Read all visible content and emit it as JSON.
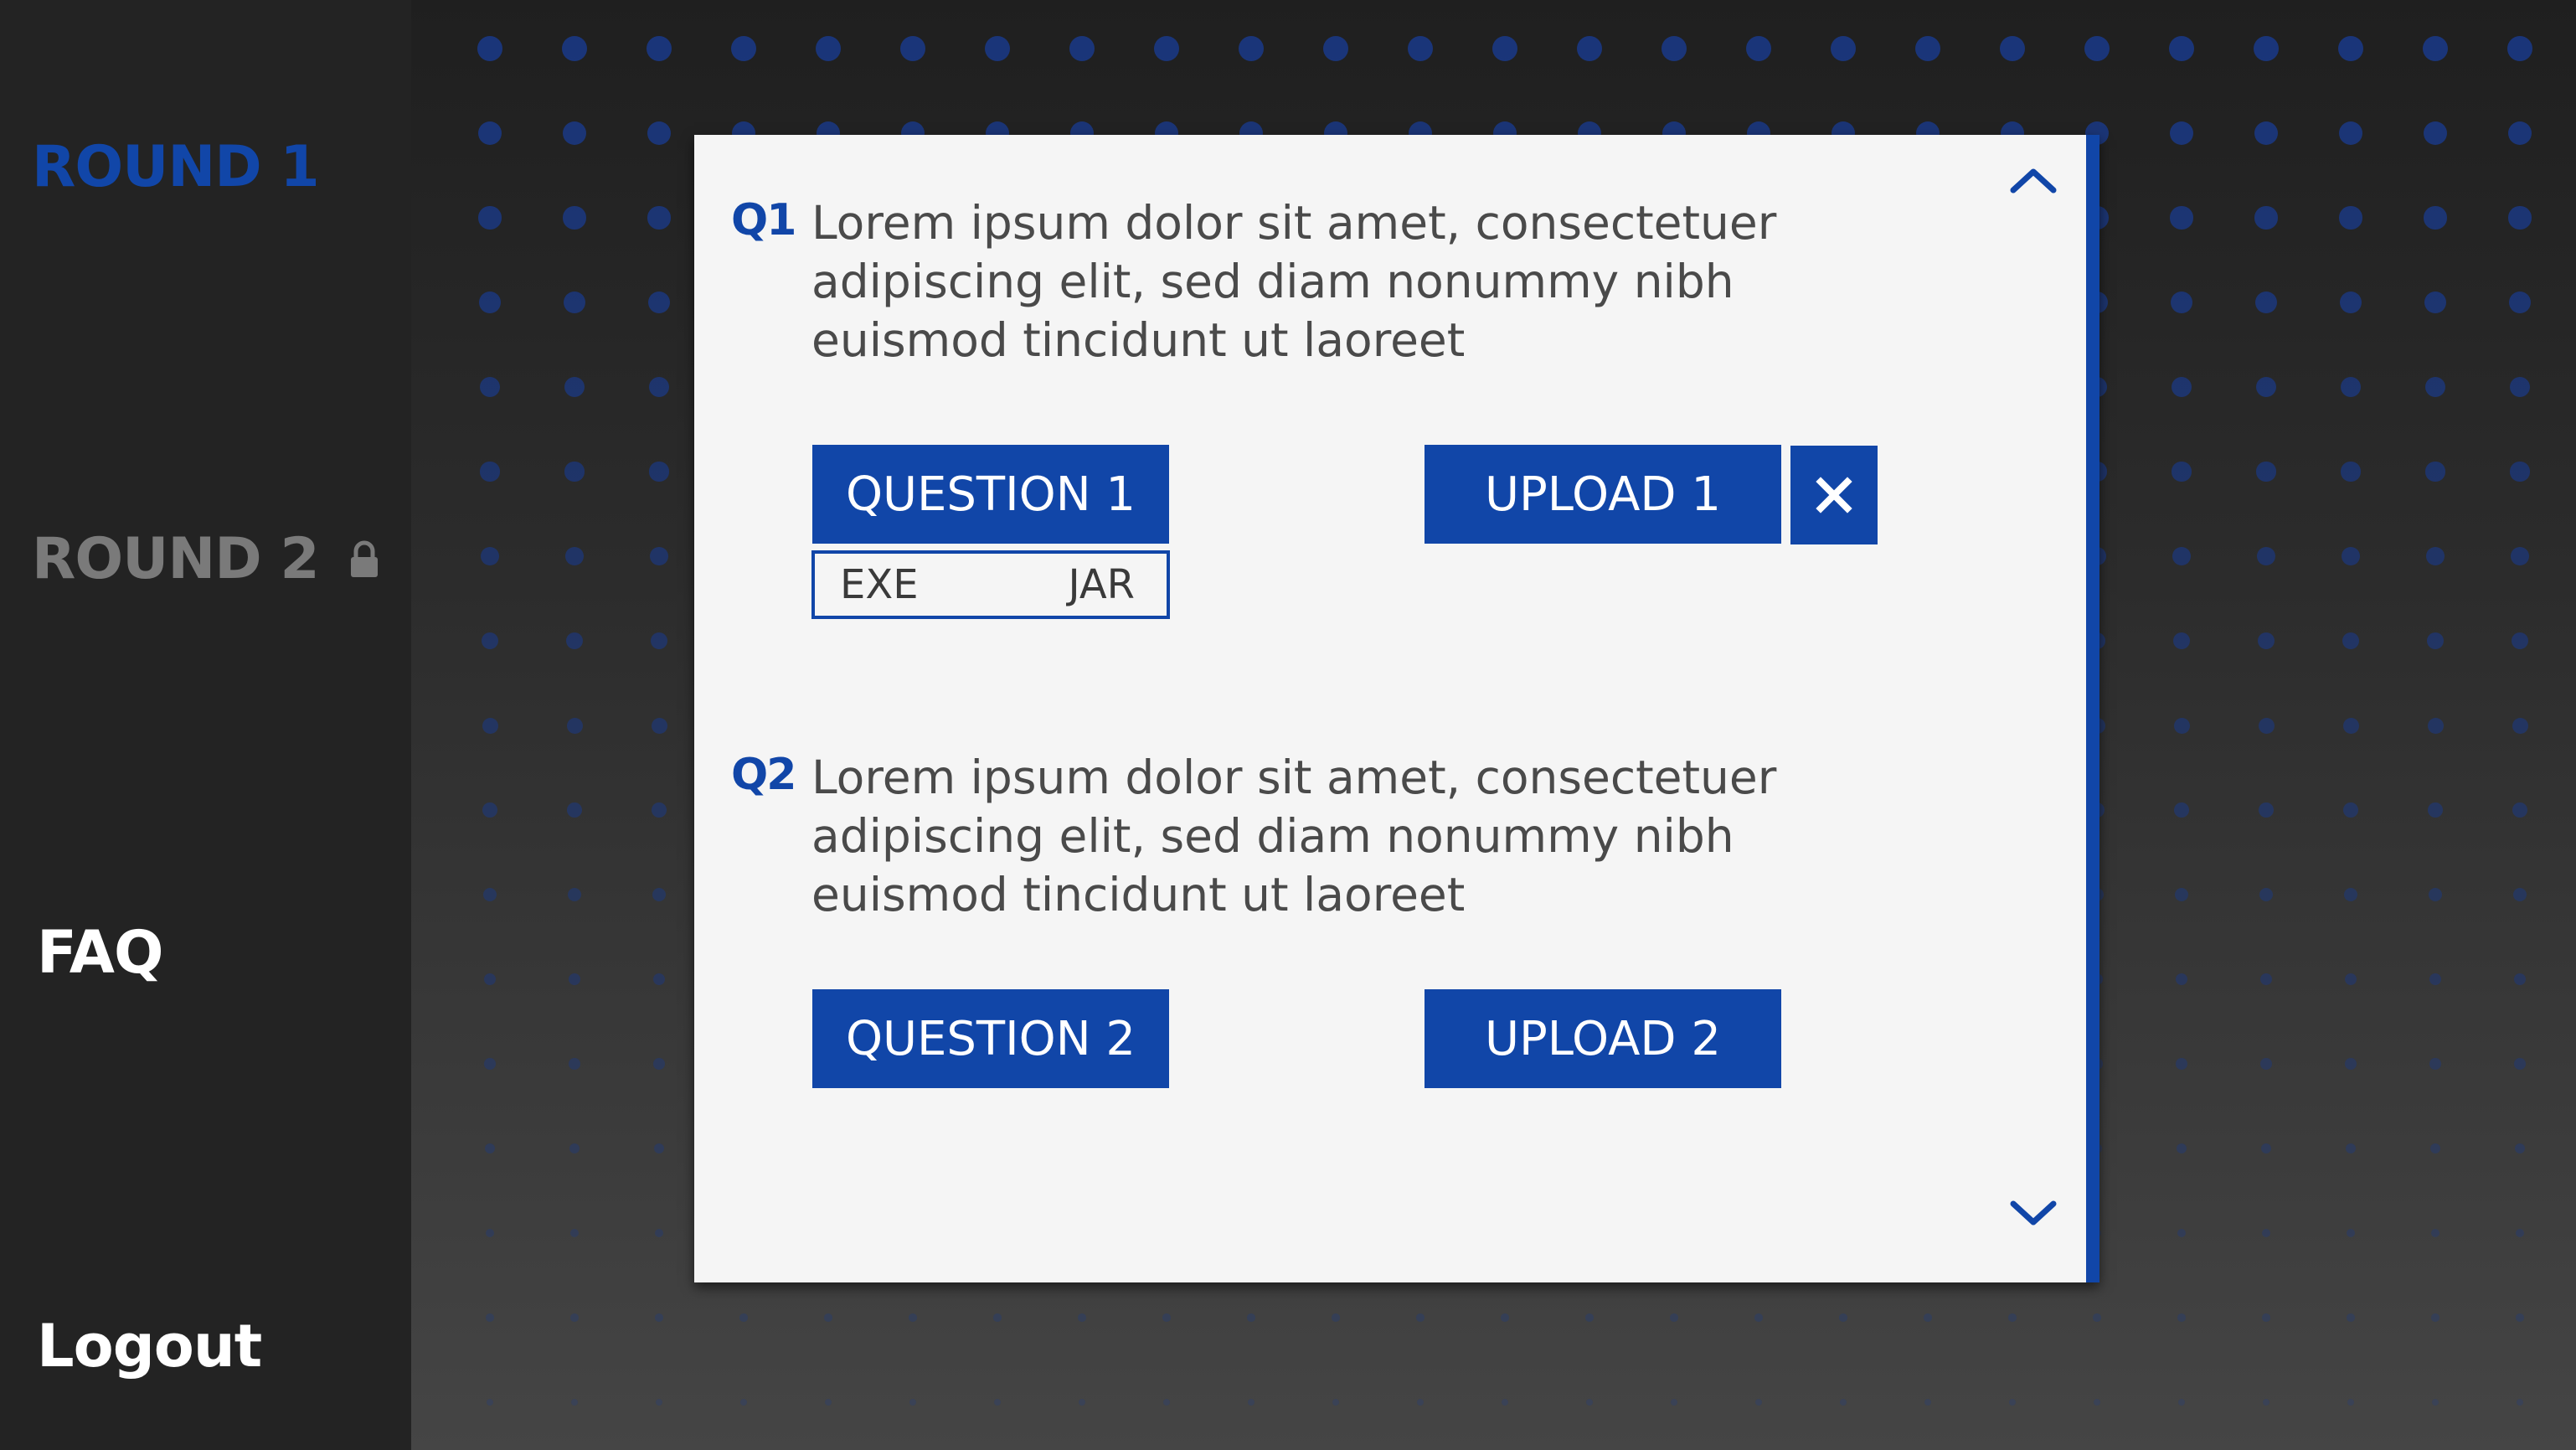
{
  "sidebar": {
    "items": [
      {
        "label": "ROUND 1",
        "state": "active",
        "color": "#1146a8"
      },
      {
        "label": "ROUND 2",
        "state": "locked",
        "color": "#7a7a7a",
        "icon": "lock-icon"
      },
      {
        "label": "FAQ",
        "state": "normal",
        "color": "#ffffff"
      },
      {
        "label": "Logout",
        "state": "normal",
        "color": "#ffffff"
      }
    ]
  },
  "panel": {
    "scroll_up_icon": "chevron-up-icon",
    "scroll_down_icon": "chevron-down-icon",
    "questions": [
      {
        "number": "Q1",
        "text": "Lorem ipsum dolor sit amet, consectetuer adipiscing elit, sed diam nonummy nibh euismod tincidunt ut laoreet",
        "question_button": "QUESTION 1",
        "upload_button": "UPLOAD 1",
        "remove_icon": "close-icon",
        "file_types": [
          "EXE",
          "JAR"
        ]
      },
      {
        "number": "Q2",
        "text": "Lorem ipsum dolor sit amet, consectetuer adipiscing elit, sed diam nonummy nibh euismod tincidunt ut laoreet",
        "question_button": "QUESTION 2",
        "upload_button": "UPLOAD 2"
      }
    ]
  },
  "colors": {
    "accent": "#1146a8",
    "sidebar_bg": "#232323",
    "panel_bg": "#f5f5f5",
    "text": "#4a4a4a"
  }
}
